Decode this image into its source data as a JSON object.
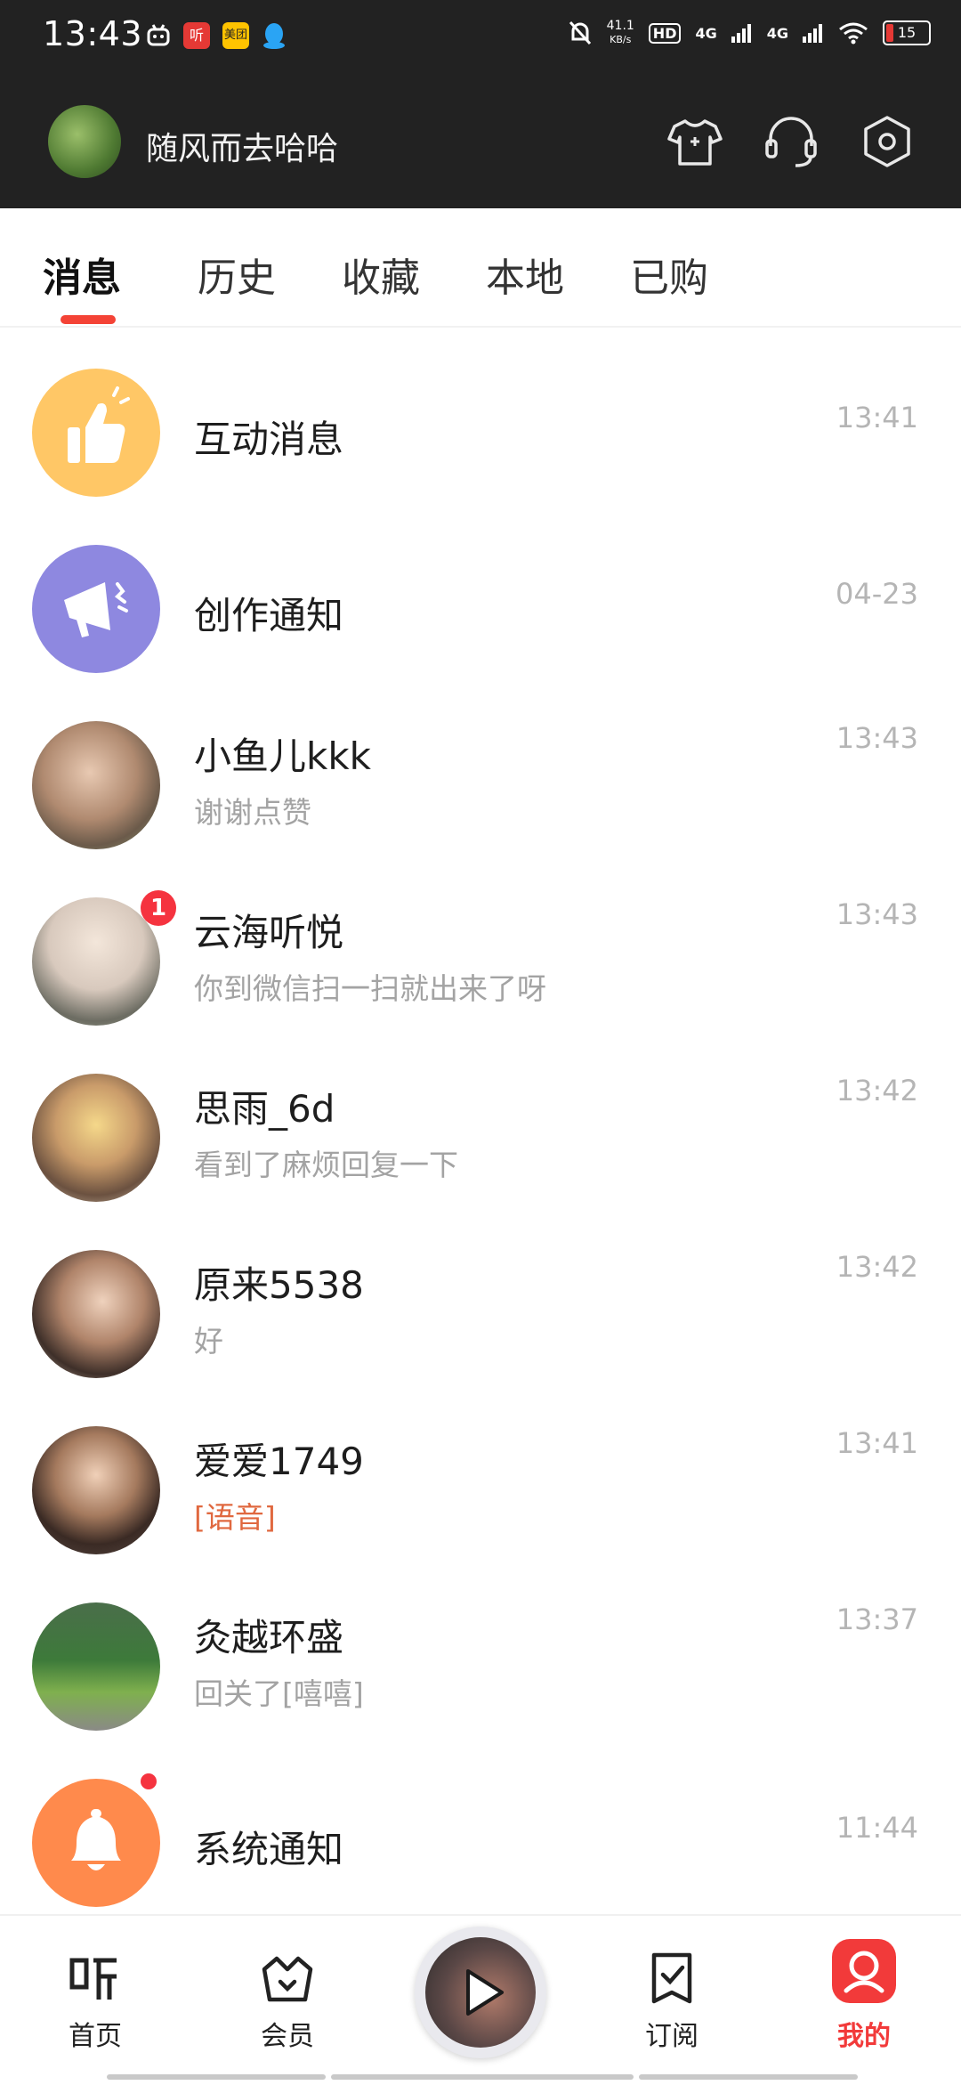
{
  "status": {
    "time": "13:43",
    "left_icons": [
      {
        "name": "bilibili-icon",
        "color": "#ffffff"
      },
      {
        "name": "ting-app-icon",
        "text": "听",
        "color": "#e53935"
      },
      {
        "name": "meituan-icon",
        "text": "美团",
        "color": "#ffc300"
      },
      {
        "name": "qq-icon",
        "color": "#2aa4f4"
      }
    ],
    "netspeed": {
      "value": "41.1",
      "unit": "KB/s"
    },
    "hd": "HD",
    "network": [
      "4G",
      "4G"
    ],
    "battery": "15"
  },
  "header": {
    "username": "随风而去哈哈",
    "icons": [
      "tshirt-icon",
      "headset-icon",
      "settings-icon"
    ]
  },
  "tabs": [
    {
      "label": "消息",
      "active": true
    },
    {
      "label": "历史",
      "active": false
    },
    {
      "label": "收藏",
      "active": false
    },
    {
      "label": "本地",
      "active": false
    },
    {
      "label": "已购",
      "active": false
    }
  ],
  "messages": [
    {
      "name": "互动消息",
      "preview": "",
      "time": "13:41",
      "avatar": "like-icon",
      "avatar_color": "#ffc766"
    },
    {
      "name": "创作通知",
      "preview": "",
      "time": "04-23",
      "avatar": "megaphone-icon",
      "avatar_color": "#8e88e0"
    },
    {
      "name": "小鱼儿kkk",
      "preview": "谢谢点赞",
      "time": "13:43",
      "avatar": "user-avatar"
    },
    {
      "name": "云海听悦",
      "preview": "你到微信扫一扫就出来了呀",
      "time": "13:43",
      "avatar": "user-avatar",
      "badge": "1"
    },
    {
      "name": "思雨_6d",
      "preview": "看到了麻烦回复一下",
      "time": "13:42",
      "avatar": "user-avatar"
    },
    {
      "name": "原来5538",
      "preview": "好",
      "time": "13:42",
      "avatar": "user-avatar"
    },
    {
      "name": "爱爱1749",
      "preview": "[语音]",
      "time": "13:41",
      "avatar": "user-avatar",
      "preview_style": "voice"
    },
    {
      "name": "灸越环盛",
      "preview": "回关了[嘻嘻]",
      "time": "13:37",
      "avatar": "user-avatar"
    },
    {
      "name": "系统通知",
      "preview": "",
      "time": "11:44",
      "avatar": "bell-icon",
      "avatar_color": "#ff8a4c",
      "dot": true
    }
  ],
  "bottom_nav": [
    {
      "label": "首页",
      "icon": "ting-logo-icon",
      "active": false
    },
    {
      "label": "会员",
      "icon": "basket-icon",
      "active": false
    },
    {
      "label": "订阅",
      "icon": "subscribe-icon",
      "active": false
    },
    {
      "label": "我的",
      "icon": "profile-icon",
      "active": true
    }
  ],
  "colors": {
    "accent": "#f44336",
    "header_bg": "#222222"
  }
}
